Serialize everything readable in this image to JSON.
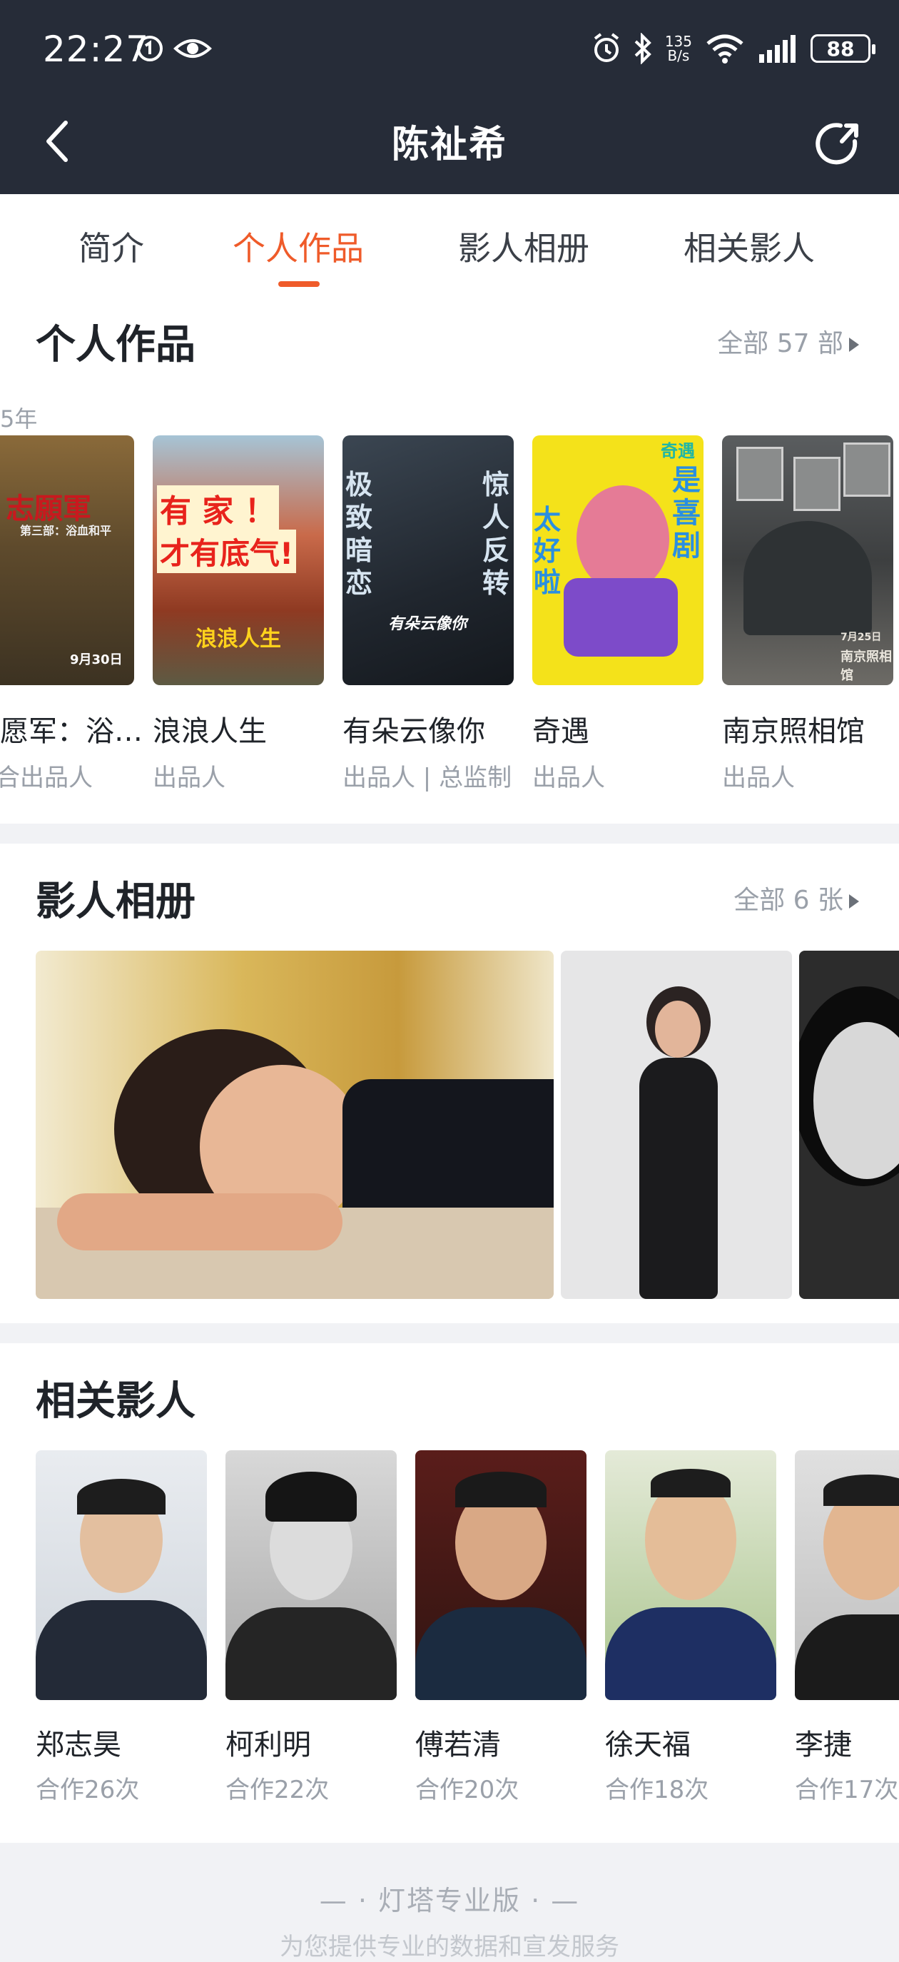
{
  "status_bar": {
    "time": "22:27",
    "speed_top": "135",
    "speed_bottom": "B/s",
    "battery": "88"
  },
  "nav": {
    "title": "陈祉希"
  },
  "tabs": [
    {
      "label": "简介"
    },
    {
      "label": "个人作品"
    },
    {
      "label": "影人相册"
    },
    {
      "label": "相关影人"
    }
  ],
  "works": {
    "title": "个人作品",
    "more": "全部 57 部",
    "year_label": "5年",
    "items": [
      {
        "title": "愿军：浴…",
        "role": "合出品人"
      },
      {
        "title": "浪浪人生",
        "role": "出品人"
      },
      {
        "title": "有朵云像你",
        "role": "出品人 | 总监制"
      },
      {
        "title": "奇遇",
        "role": "出品人"
      },
      {
        "title": "南京照相馆",
        "role": "出品人"
      }
    ],
    "poster_texts": {
      "p1": "志願軍",
      "p1b": "第三部：浴血和平",
      "p1c": "9月30日",
      "p2": "有 家 ！",
      "p2b": "才有底气!",
      "p2c": "浪浪人生",
      "p3a": "极致暗恋",
      "p3b": "惊人反转",
      "p3c": "有朵云像你",
      "p4a": "太好啦",
      "p4b": "是喜剧",
      "p4c": "奇遇",
      "p5a": "7月25日",
      "p5b": "南京照相馆"
    }
  },
  "album": {
    "title": "影人相册",
    "more": "全部 6 张"
  },
  "related": {
    "title": "相关影人",
    "people": [
      {
        "name": "郑志昊",
        "count": "合作26次"
      },
      {
        "name": "柯利明",
        "count": "合作22次"
      },
      {
        "name": "傅若清",
        "count": "合作20次"
      },
      {
        "name": "徐天福",
        "count": "合作18次"
      },
      {
        "name": "李捷",
        "count": "合作17次"
      }
    ]
  },
  "footer": {
    "title": "灯塔专业版",
    "subtitle": "为您提供专业的数据和宣发服务"
  },
  "colors": {
    "accent": "#ef5b2a",
    "header_bg": "#262c38"
  }
}
